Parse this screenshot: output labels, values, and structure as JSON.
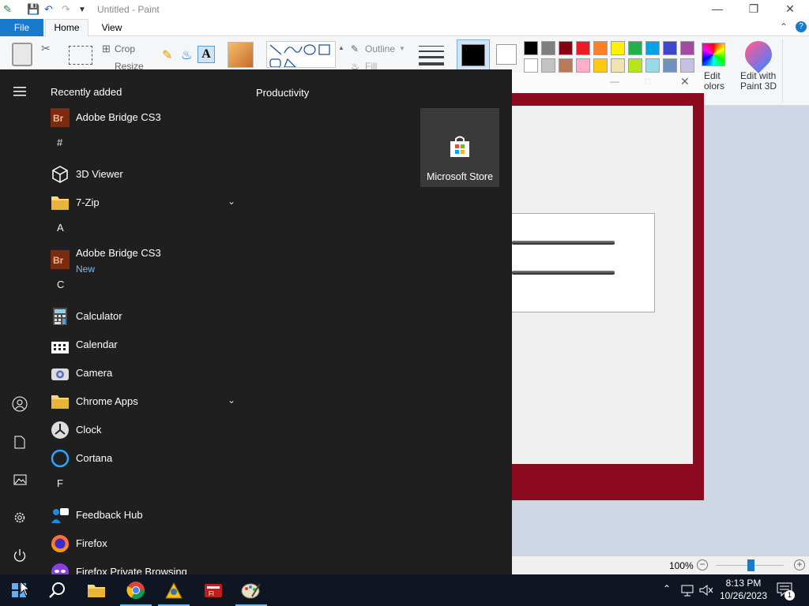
{
  "paint": {
    "title": "Untitled - Paint",
    "tabs": [
      "File",
      "Home",
      "View"
    ],
    "ribbon": {
      "crop": "Crop",
      "resize": "Resize",
      "outline": "Outline",
      "fill": "Fill",
      "edit_colors": "Edit colors",
      "edit_colors_visible": "Edit\nolors",
      "edit_paint3d": "Edit with Paint 3D"
    },
    "palette_row1": [
      "#000000",
      "#7f7f7f",
      "#880015",
      "#ed1c24",
      "#ff7f27",
      "#fff200",
      "#22b14c",
      "#00a2e8",
      "#3f48cc",
      "#a349a4"
    ],
    "palette_row2": [
      "#ffffff",
      "#c3c3c3",
      "#b97a57",
      "#ffaec9",
      "#ffc90e",
      "#efe4b0",
      "#b5e61d",
      "#99d9ea",
      "#7092be",
      "#c8bfe7"
    ],
    "color1": "#000000",
    "color2": "#ffffff",
    "zoom": "100%"
  },
  "start_menu": {
    "recently_added": "Recently added",
    "productivity": "Productivity",
    "entries": [
      {
        "type": "app",
        "name": "Adobe Bridge CS3",
        "icon": "adobe-bridge-icon"
      },
      {
        "type": "letter",
        "name": "#"
      },
      {
        "type": "app",
        "name": "3D Viewer",
        "icon": "3d-viewer-icon"
      },
      {
        "type": "folder",
        "name": "7-Zip",
        "icon": "folder-icon"
      },
      {
        "type": "letter",
        "name": "A"
      },
      {
        "type": "app",
        "name": "Adobe Bridge CS3",
        "sub": "New",
        "icon": "adobe-bridge-icon"
      },
      {
        "type": "letter",
        "name": "C"
      },
      {
        "type": "app",
        "name": "Calculator",
        "icon": "calculator-icon"
      },
      {
        "type": "app",
        "name": "Calendar",
        "icon": "calendar-icon"
      },
      {
        "type": "app",
        "name": "Camera",
        "icon": "camera-icon"
      },
      {
        "type": "folder",
        "name": "Chrome Apps",
        "icon": "folder-icon"
      },
      {
        "type": "app",
        "name": "Clock",
        "icon": "clock-icon"
      },
      {
        "type": "app",
        "name": "Cortana",
        "icon": "cortana-icon"
      },
      {
        "type": "letter",
        "name": "F"
      },
      {
        "type": "app",
        "name": "Feedback Hub",
        "icon": "feedback-hub-icon"
      },
      {
        "type": "app",
        "name": "Firefox",
        "icon": "firefox-icon"
      },
      {
        "type": "app",
        "name": "Firefox Private Browsing",
        "icon": "firefox-private-icon"
      }
    ],
    "tile_store": "Microsoft Store"
  },
  "taskbar": {
    "time": "8:13 PM",
    "date": "10/26/2023",
    "notifications": "1"
  }
}
